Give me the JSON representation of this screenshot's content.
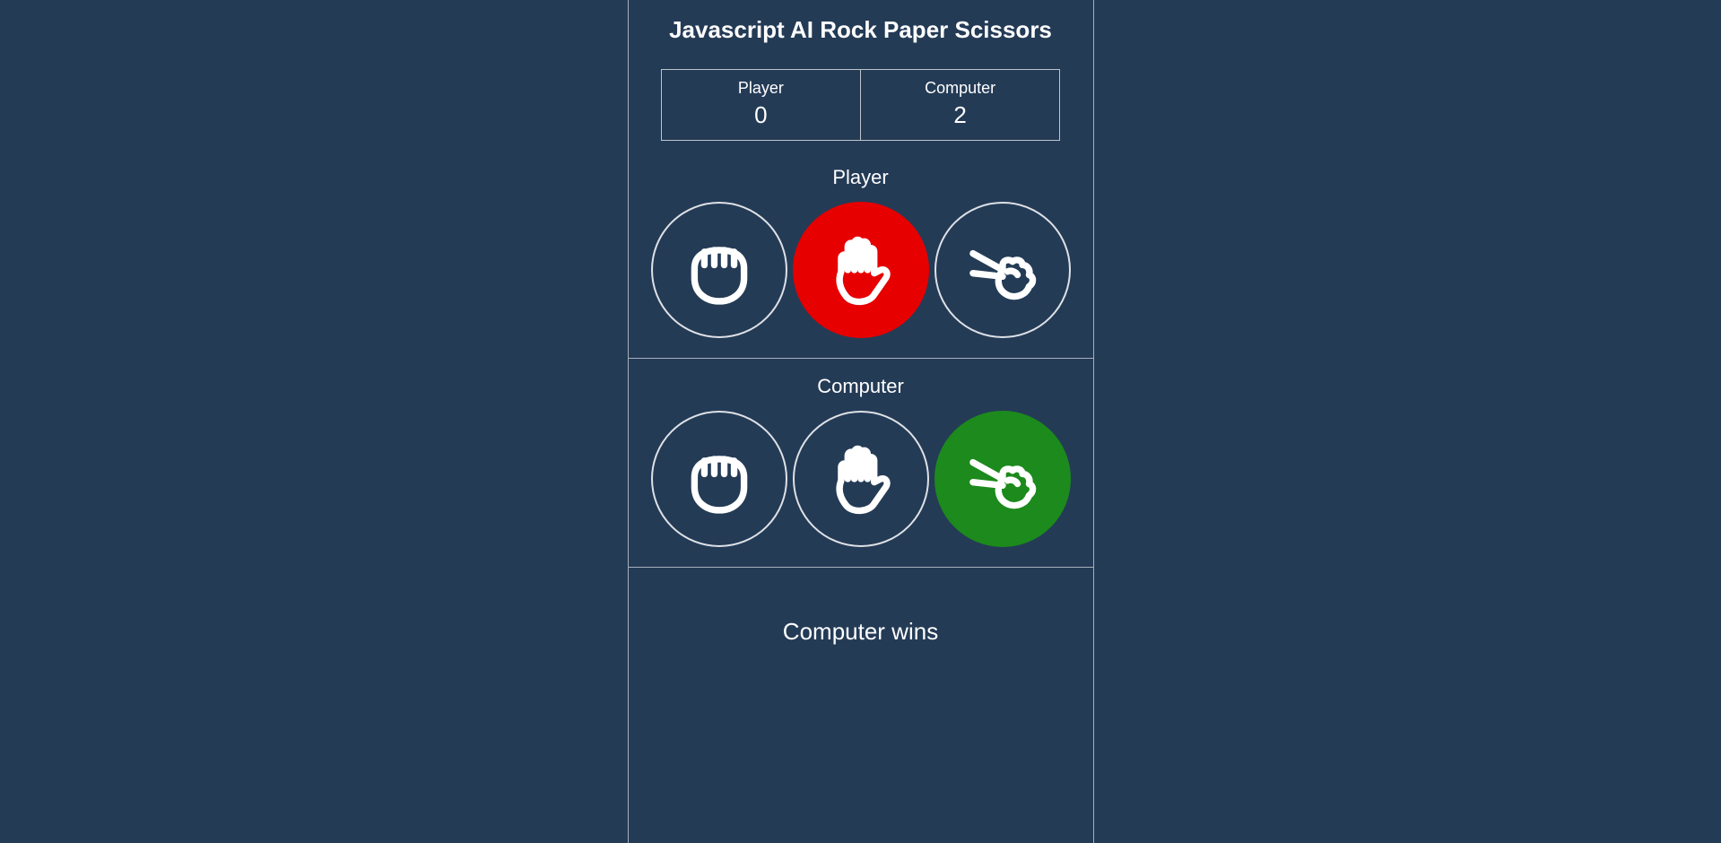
{
  "title": "Javascript AI Rock Paper Scissors",
  "scoreboard": {
    "player_label": "Player",
    "player_score": "0",
    "computer_label": "Computer",
    "computer_score": "2"
  },
  "player_panel": {
    "header": "Player",
    "selected": "paper",
    "selected_state": "lose"
  },
  "computer_panel": {
    "header": "Computer",
    "selected": "scissors",
    "selected_state": "win"
  },
  "result_text": "Computer wins",
  "colors": {
    "bg": "#243b56",
    "win": "#1c8a1c",
    "lose": "#e60000"
  },
  "choices": [
    "rock",
    "paper",
    "scissors"
  ]
}
